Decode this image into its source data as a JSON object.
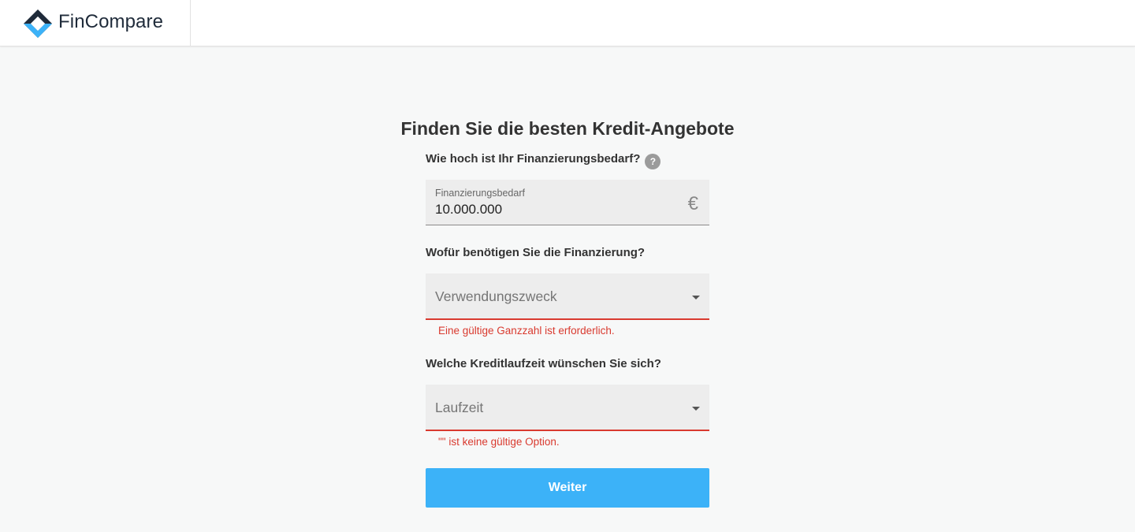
{
  "header": {
    "brand_name": "FinCompare",
    "brand_colors": {
      "dark": "#1f2b3a",
      "light": "#3cb2f8"
    }
  },
  "form": {
    "title": "Finden Sie die besten Kredit-Angebote",
    "amount": {
      "question": "Wie hoch ist Ihr Finanzierungsbedarf?",
      "help_icon": "?",
      "label": "Finanzierungsbedarf",
      "value": "10.000.000",
      "currency_symbol": "€"
    },
    "purpose": {
      "question": "Wofür benötigen Sie die Finanzierung?",
      "placeholder": "Verwendungszweck",
      "error": "Eine gültige Ganzzahl ist erforderlich."
    },
    "term": {
      "question": "Welche Kreditlaufzeit wünschen Sie sich?",
      "placeholder": "Laufzeit",
      "error": "\"\" ist keine gültige Option."
    },
    "submit_label": "Weiter"
  },
  "colors": {
    "accent": "#3cb2f8",
    "error": "#d93a2f",
    "field_bg": "#ededed",
    "page_bg": "#f7f8f8"
  }
}
